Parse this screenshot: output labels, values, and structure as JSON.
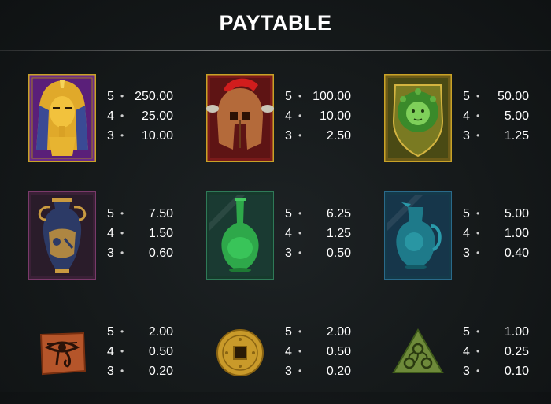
{
  "title": "PAYTABLE",
  "symbols": [
    {
      "icon": "pharaoh-icon",
      "pays": [
        {
          "count": "5",
          "value": "250.00"
        },
        {
          "count": "4",
          "value": "25.00"
        },
        {
          "count": "3",
          "value": "10.00"
        }
      ]
    },
    {
      "icon": "spartan-helmet-icon",
      "pays": [
        {
          "count": "5",
          "value": "100.00"
        },
        {
          "count": "4",
          "value": "10.00"
        },
        {
          "count": "3",
          "value": "2.50"
        }
      ]
    },
    {
      "icon": "medusa-icon",
      "pays": [
        {
          "count": "5",
          "value": "50.00"
        },
        {
          "count": "4",
          "value": "5.00"
        },
        {
          "count": "3",
          "value": "1.25"
        }
      ]
    },
    {
      "icon": "amphora-icon",
      "pays": [
        {
          "count": "5",
          "value": "7.50"
        },
        {
          "count": "4",
          "value": "1.50"
        },
        {
          "count": "3",
          "value": "0.60"
        }
      ]
    },
    {
      "icon": "green-vase-icon",
      "pays": [
        {
          "count": "5",
          "value": "6.25"
        },
        {
          "count": "4",
          "value": "1.25"
        },
        {
          "count": "3",
          "value": "0.50"
        }
      ]
    },
    {
      "icon": "blue-jug-icon",
      "pays": [
        {
          "count": "5",
          "value": "5.00"
        },
        {
          "count": "4",
          "value": "1.00"
        },
        {
          "count": "3",
          "value": "0.40"
        }
      ]
    },
    {
      "icon": "eye-of-horus-icon",
      "pays": [
        {
          "count": "5",
          "value": "2.00"
        },
        {
          "count": "4",
          "value": "0.50"
        },
        {
          "count": "3",
          "value": "0.20"
        }
      ]
    },
    {
      "icon": "coin-icon",
      "pays": [
        {
          "count": "5",
          "value": "2.00"
        },
        {
          "count": "4",
          "value": "0.50"
        },
        {
          "count": "3",
          "value": "0.20"
        }
      ]
    },
    {
      "icon": "triskelion-stone-icon",
      "pays": [
        {
          "count": "5",
          "value": "1.00"
        },
        {
          "count": "4",
          "value": "0.25"
        },
        {
          "count": "3",
          "value": "0.10"
        }
      ]
    }
  ]
}
